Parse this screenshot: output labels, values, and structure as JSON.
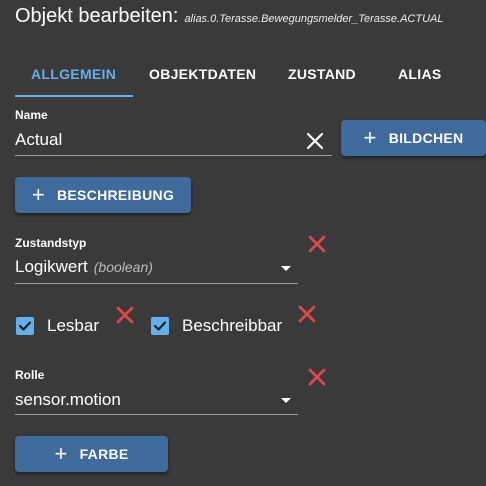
{
  "dialog": {
    "title": "Objekt bearbeiten:",
    "object_id": "alias.0.Terasse.Bewegungsmelder_Terasse.ACTUAL"
  },
  "tabs": [
    {
      "label": "ALLGEMEIN",
      "active": true
    },
    {
      "label": "OBJEKTDATEN",
      "active": false
    },
    {
      "label": "ZUSTAND",
      "active": false
    },
    {
      "label": "ALIAS",
      "active": false
    }
  ],
  "name_field": {
    "label": "Name",
    "value": "Actual",
    "clear_icon": "close-icon"
  },
  "buttons": {
    "image": "BILDCHEN",
    "description": "BESCHREIBUNG",
    "color": "FARBE"
  },
  "state_type": {
    "label": "Zustandstyp",
    "value": "Logikwert",
    "hint": "(boolean)"
  },
  "checkboxes": {
    "read": {
      "label": "Lesbar",
      "checked": true
    },
    "write": {
      "label": "Beschreibbar",
      "checked": true
    }
  },
  "role": {
    "label": "Rolle",
    "value": "sensor.motion"
  },
  "colors": {
    "background": "#3a3a3a",
    "accent": "#62b0f0",
    "button": "#3e6a9c",
    "delete": "#e0474c"
  }
}
